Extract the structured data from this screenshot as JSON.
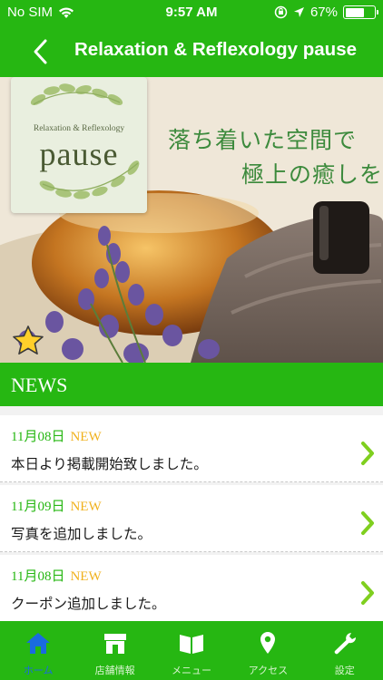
{
  "status_bar": {
    "carrier": "No SIM",
    "time": "9:57 AM",
    "battery": "67%",
    "battery_fraction": 0.67
  },
  "nav": {
    "title": "Relaxation & Reflexology pause",
    "back_icon": "chevron-left-icon"
  },
  "hero": {
    "logo_small": "Relaxation & Reflexology",
    "logo_main": "pause",
    "tagline_line1": "落ち着いた空間で",
    "tagline_line2": "極上の癒しを",
    "star_icon": "star-icon"
  },
  "news": {
    "header": "NEWS",
    "items": [
      {
        "date": "11月08日",
        "badge": "NEW",
        "text": "本日より掲載開始致しました。"
      },
      {
        "date": "11月09日",
        "badge": "NEW",
        "text": "写真を追加しました。"
      },
      {
        "date": "11月08日",
        "badge": "NEW",
        "text": "クーポン追加しました。"
      }
    ]
  },
  "tabs": [
    {
      "label": "ホーム",
      "icon": "home-icon",
      "active": true
    },
    {
      "label": "店舗情報",
      "icon": "shop-icon",
      "active": false
    },
    {
      "label": "メニュー",
      "icon": "book-icon",
      "active": false
    },
    {
      "label": "アクセス",
      "icon": "map-pin-icon",
      "active": false
    },
    {
      "label": "設定",
      "icon": "wrench-icon",
      "active": false
    }
  ],
  "colors": {
    "brand_green": "#26b712",
    "news_date": "#26b712",
    "news_badge": "#f0b21e",
    "tab_active": "#1a6be0"
  }
}
